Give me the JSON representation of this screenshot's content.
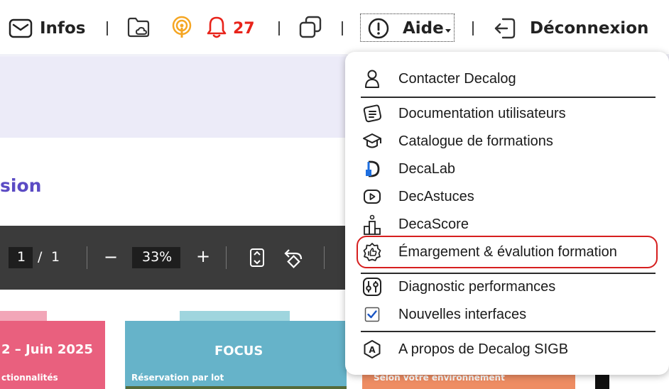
{
  "topbar": {
    "infos_label": "Infos",
    "notifications_count": "27",
    "aide_label": "Aide",
    "logout_label": "Déconnexion"
  },
  "page": {
    "title_fragment": "sion"
  },
  "pdf_toolbar": {
    "page_current": "1",
    "page_separator": "/",
    "page_total": "1",
    "zoom_minus": "−",
    "zoom_value": "33%",
    "zoom_plus": "+"
  },
  "cards": {
    "pink_title": "2 – Juin 2025",
    "pink_sub": "ctionnalités",
    "teal_title": "FOCUS",
    "teal_sub": "Réservation par lot",
    "orange_sub": "Selon votre environnement"
  },
  "help_menu": {
    "items": [
      {
        "label": "Contacter Decalog",
        "icon": "person-icon"
      },
      {
        "label": "Documentation utilisateurs",
        "icon": "documentation-icon"
      },
      {
        "label": "Catalogue de formations",
        "icon": "graduation-cap-icon"
      },
      {
        "label": "DecaLab",
        "icon": "decalab-icon"
      },
      {
        "label": "DecAstuces",
        "icon": "video-play-icon"
      },
      {
        "label": "DecaScore",
        "icon": "podium-icon"
      },
      {
        "label": "Émargement & évalution formation",
        "icon": "thumbs-up-badge-icon"
      },
      {
        "label": "Diagnostic performances",
        "icon": "sliders-icon"
      },
      {
        "label": "Nouvelles interfaces",
        "icon": "checkbox-checked-icon"
      },
      {
        "label": "A propos de Decalog SIGB",
        "icon": "a-badge-icon"
      }
    ],
    "highlight_color": "#d61f1f"
  },
  "colors": {
    "accent": "#5b4bc4",
    "notification_red": "#e8231a",
    "podcast_orange": "#f5a623",
    "decalab_blue": "#1e6fe0"
  }
}
